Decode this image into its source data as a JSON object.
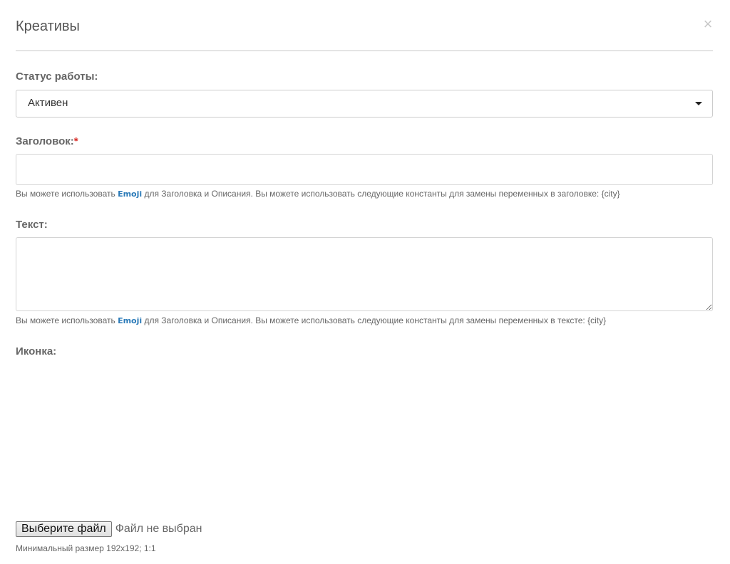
{
  "modal": {
    "title": "Креативы",
    "close_glyph": "×"
  },
  "status": {
    "label": "Статус работы:",
    "selected_value": "Активен"
  },
  "headline": {
    "label": "Заголовок:",
    "required_mark": "*",
    "value": "",
    "help_prefix": "Вы можете использовать ",
    "help_link": "Emoji",
    "help_suffix": " для Заголовка и Описания. Вы можете использовать следующие константы для замены переменных в заголовке: {city}"
  },
  "text": {
    "label": "Текст:",
    "value": "",
    "help_prefix": "Вы можете использовать ",
    "help_link": "Emoji",
    "help_suffix": " для Заголовка и Описания. Вы можете использовать следующие константы для замены переменных в тексте: {city}"
  },
  "icon": {
    "label": "Иконка:",
    "file_button_label": "Выберите файл",
    "file_status": "Файл не выбран",
    "hint": "Минимальный размер 192x192; 1:1"
  },
  "icons": {
    "close": "close-icon",
    "select_caret": "caret-down-icon"
  },
  "colors": {
    "required": "#d9302b",
    "link": "#2a7ab8"
  }
}
